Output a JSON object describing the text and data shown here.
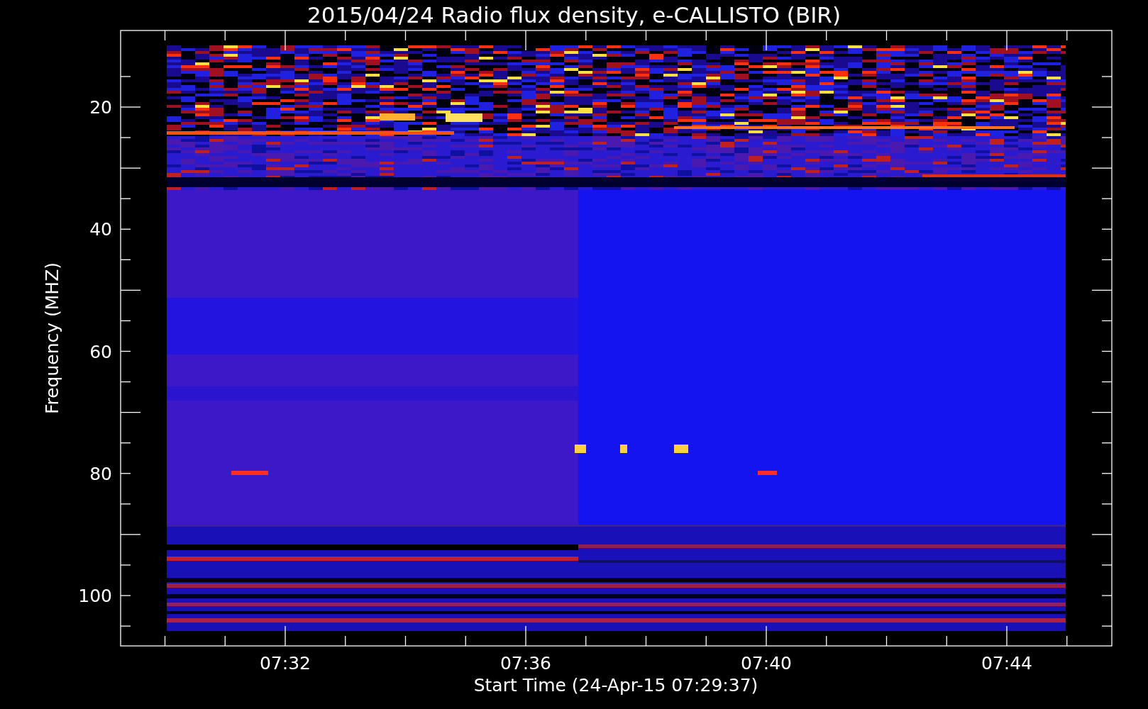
{
  "title": "2015/04/24  Radio flux density, e-CALLISTO (BIR)",
  "y_axis": {
    "label": "Frequency (MHZ)",
    "tick_labels": [
      "20",
      "40",
      "60",
      "80",
      "100"
    ]
  },
  "x_axis": {
    "label": "Start Time (24-Apr-15 07:29:37)",
    "tick_labels": [
      "07:32",
      "07:36",
      "07:40",
      "07:44"
    ]
  }
}
